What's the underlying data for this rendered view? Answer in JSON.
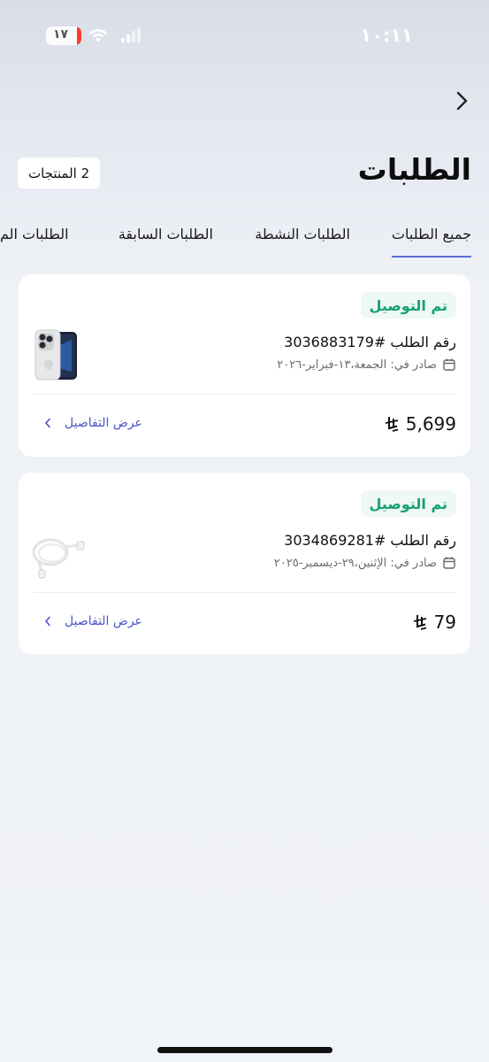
{
  "status_bar": {
    "time": "١٠:١١",
    "battery": "١٧"
  },
  "header": {
    "title": "الطلبات",
    "products_count": "2 المنتجات"
  },
  "tabs": [
    {
      "label": "جميع الطلبات",
      "active": true
    },
    {
      "label": "الطلبات النشطة",
      "active": false
    },
    {
      "label": "الطلبات السابقة",
      "active": false
    },
    {
      "label": "الطلبات الم",
      "active": false
    }
  ],
  "orders": [
    {
      "status": "تم التوصيل",
      "order_number": "رقم الطلب #3036883179",
      "date": "صادر في: الجمعة،١٣-فبراير-٢٠٢٦",
      "price": "5,699",
      "details_label": "عرض التفاصيل",
      "product_icon": "iphone-image"
    },
    {
      "status": "تم التوصيل",
      "order_number": "رقم الطلب #3034869281",
      "date": "صادر في: الإثنين،٢٩-ديسمبر-٢٠٢٥",
      "price": "79",
      "details_label": "عرض التفاصيل",
      "product_icon": "usb-c-cable-image"
    }
  ],
  "colors": {
    "accent": "#4a56c8",
    "delivered_text": "#16a172",
    "delivered_bg": "#eef8f4"
  }
}
